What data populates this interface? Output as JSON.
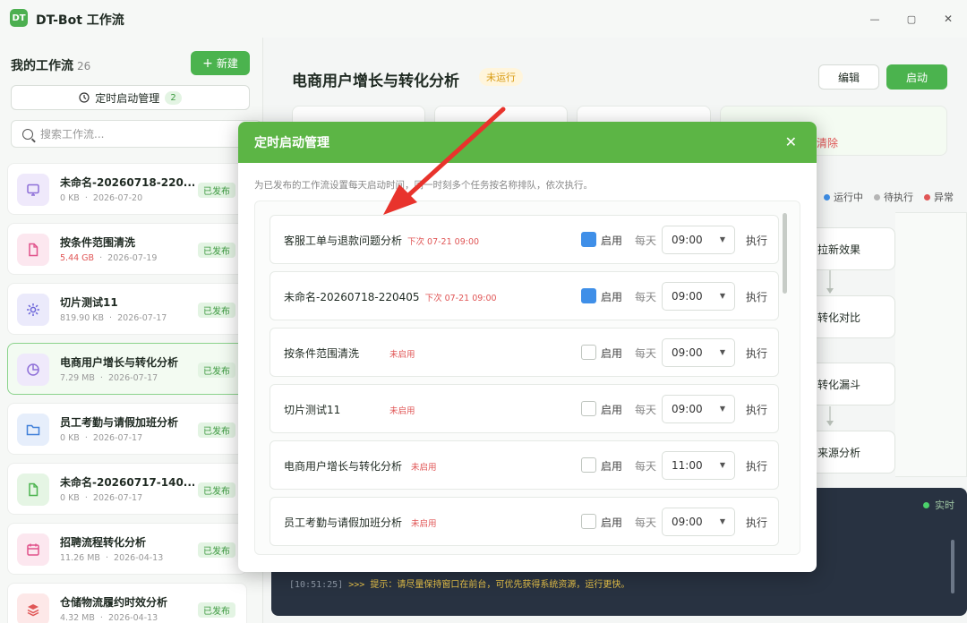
{
  "app": {
    "logo": "DT",
    "title": "DT-Bot 工作流"
  },
  "window": {
    "minimize": "—",
    "maximize": "▢",
    "close": "✕"
  },
  "sidebar": {
    "title": "我的工作流",
    "count": "26",
    "new_button": "新建",
    "schedule_button": "定时启动管理",
    "schedule_count": "2",
    "search_placeholder": "搜索工作流...",
    "items": [
      {
        "name": "未命名-20260718-220...",
        "size": "0 KB",
        "date": "2026-07-20",
        "badge": "已发布",
        "icon": "monitor-icon",
        "color": "#8e6fd8",
        "bg": "#efe9fb"
      },
      {
        "name": "按条件范围清洗",
        "size": "5.44 GB",
        "date": "2026-07-19",
        "badge": "已发布",
        "icon": "file-icon",
        "color": "#e0518a",
        "bg": "#fce7ef"
      },
      {
        "name": "切片测试11",
        "size": "819.90 KB",
        "date": "2026-07-17",
        "badge": "已发布",
        "icon": "gear-icon",
        "color": "#6d66d9",
        "bg": "#ebeafb"
      },
      {
        "name": "电商用户增长与转化分析",
        "size": "7.29 MB",
        "date": "2026-07-17",
        "badge": "已发布",
        "icon": "pie-chart-icon",
        "color": "#8e6fd8",
        "bg": "#efe9fb"
      },
      {
        "name": "员工考勤与请假加班分析",
        "size": "0 KB",
        "date": "2026-07-17",
        "badge": "已发布",
        "icon": "folder-icon",
        "color": "#3f7fd9",
        "bg": "#e6eefb"
      },
      {
        "name": "未命名-20260717-140...",
        "size": "0 KB",
        "date": "2026-07-17",
        "badge": "已发布",
        "icon": "file-icon",
        "color": "#4bb34e",
        "bg": "#e5f5e4"
      },
      {
        "name": "招聘流程转化分析",
        "size": "11.26 MB",
        "date": "2026-04-13",
        "badge": "已发布",
        "icon": "calendar-icon",
        "color": "#e0518a",
        "bg": "#fce7ef"
      },
      {
        "name": "仓储物流履约时效分析",
        "size": "4.32 MB",
        "date": "2026-04-13",
        "badge": "已发布",
        "icon": "layers-icon",
        "color": "#e05656",
        "bg": "#fde8e8"
      }
    ]
  },
  "main": {
    "title": "电商用户增长与转化分析",
    "status": "未运行",
    "edit_button": "编辑",
    "start_button": "启动",
    "clear_link": "清除",
    "legend": [
      {
        "label": "运行中",
        "color": "#3f8fe8"
      },
      {
        "label": "待执行",
        "color": "#b5b5b5"
      },
      {
        "label": "异常",
        "color": "#e05656"
      }
    ],
    "nodes": [
      "拉新效果",
      "转化对比",
      "转化漏斗",
      "来源分析"
    ],
    "console": {
      "live": "实时",
      "timestamp": "[10:51:25]",
      "message": ">>> 提示：请尽量保持窗口在前台，可优先获得系统资源，运行更快。"
    }
  },
  "modal": {
    "title": "定时启动管理",
    "close": "✕",
    "description": "为已发布的工作流设置每天启动时间，同一时刻多个任务按名称排队，依次执行。",
    "enable_label": "启用",
    "daily_label": "每天",
    "run_label": "执行",
    "rows": [
      {
        "name": "客服工单与退款问题分析",
        "next": "下次 07-21 09:00",
        "off": "",
        "enabled": true,
        "time": "09:00"
      },
      {
        "name": "未命名-20260718-220405",
        "next": "下次 07-21 09:00",
        "off": "",
        "enabled": true,
        "time": "09:00"
      },
      {
        "name": "按条件范围清洗",
        "next": "",
        "off": "未启用",
        "enabled": false,
        "time": "09:00"
      },
      {
        "name": "切片测试11",
        "next": "",
        "off": "未启用",
        "enabled": false,
        "time": "09:00"
      },
      {
        "name": "电商用户增长与转化分析",
        "next": "",
        "off": "未启用",
        "enabled": false,
        "time": "11:00"
      },
      {
        "name": "员工考勤与请假加班分析",
        "next": "",
        "off": "未启用",
        "enabled": false,
        "time": "09:00"
      }
    ]
  },
  "colors": {
    "accent": "#4bb34e",
    "modal_header": "#5cb545",
    "danger": "#e05656",
    "checked": "#3f8fe8"
  }
}
